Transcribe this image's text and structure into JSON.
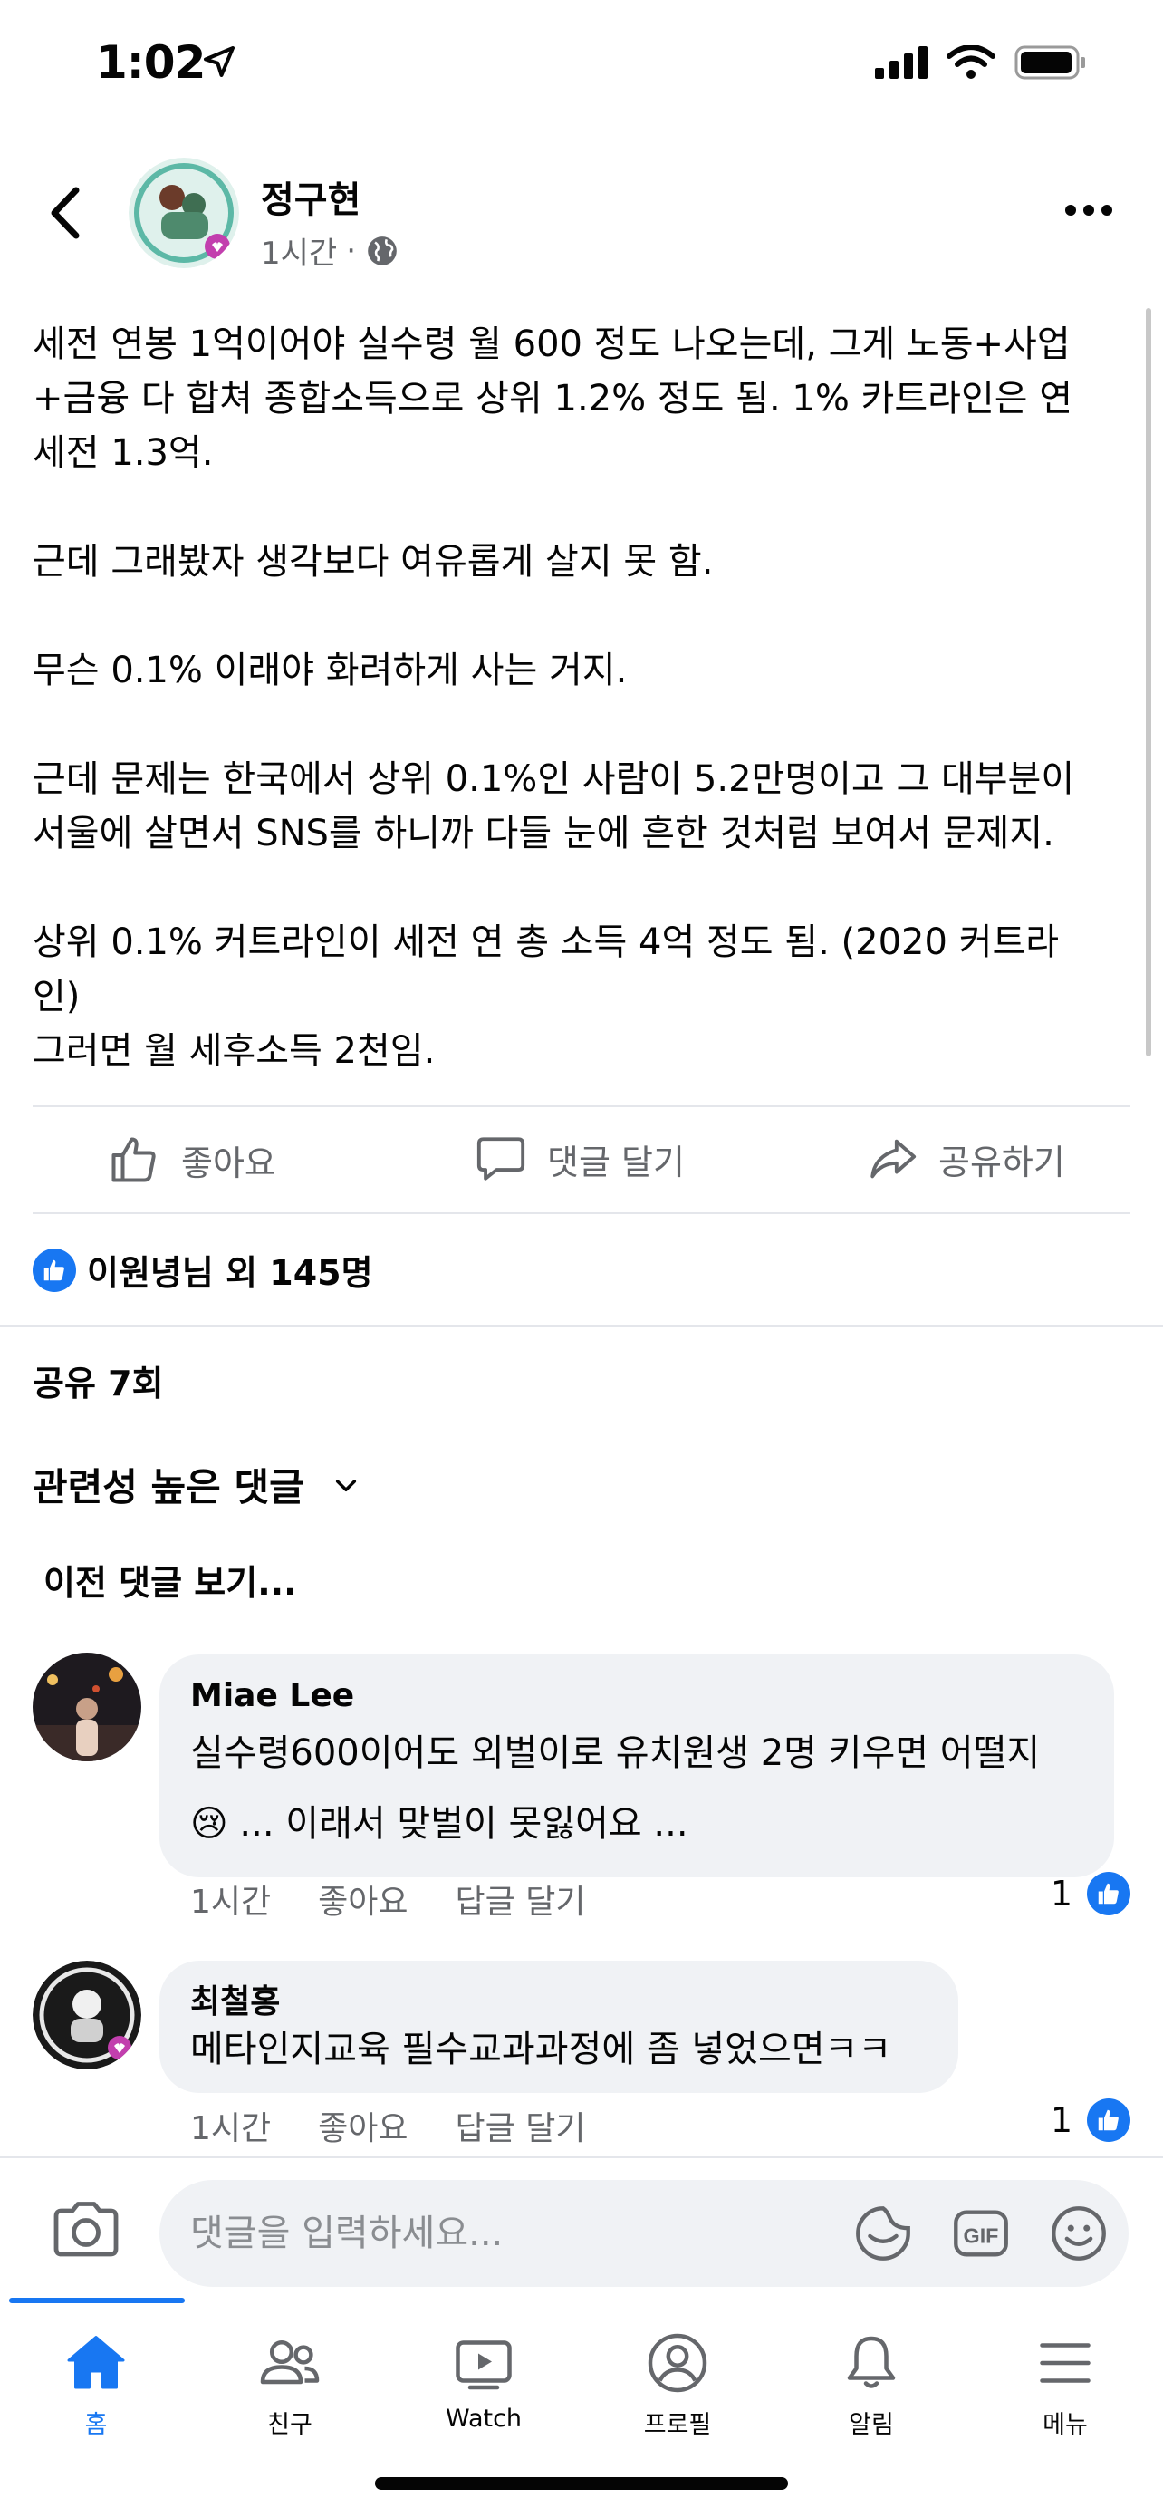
{
  "status_bar": {
    "time": "1:02"
  },
  "post": {
    "author": "정구현",
    "time": "1시간",
    "separator": "·",
    "paragraphs": [
      "세전 연봉 1억이어야 실수령 월 600 정도 나오는데, 그게 노동+사업",
      "+금융 다 합쳐 종합소득으로 상위 1.2% 정도 됨. 1% 카트라인은 연",
      "세전 1.3억.",
      "",
      "근데 그래봤자 생각보다 여유롭게 살지 못 함.",
      "",
      "무슨 0.1% 이래야 화려하게 사는 거지.",
      "",
      "근데 문제는 한국에서 상위 0.1%인 사람이 5.2만명이고 그 대부분이",
      "서울에 살면서 SNS를 하니까 다들 눈에 흔한 것처럼 보여서 문제지.",
      "",
      "상위 0.1% 커트라인이 세전 연 총 소득 4억 정도 됨. (2020 커트라",
      "인)",
      "그러면 월 세후소득 2천임."
    ]
  },
  "actions": {
    "like": "좋아요",
    "comment": "댓글 달기",
    "share": "공유하기"
  },
  "reactions": {
    "text": "이원녕님 외 145명"
  },
  "shares": "공유 7회",
  "comments_section": {
    "sort_label": "관련성 높은 댓글",
    "previous": "이전 댓글 보기..."
  },
  "comments": [
    {
      "name": "Miae Lee",
      "line1": "실수령600이어도 외벌이로 유치원생 2명 키우면 어떨지",
      "line2_emoji": "😢",
      "line2": "... 이래서 맞벌이 못잃어요 ...",
      "time": "1시간",
      "like": "좋아요",
      "reply": "답글 달기",
      "likes": "1"
    },
    {
      "name": "최철홍",
      "line1": "메타인지교육 필수교과과정에 좀 넣었으면ㅋㅋ",
      "time": "1시간",
      "like": "좋아요",
      "reply": "답글 달기",
      "likes": "1"
    }
  ],
  "input": {
    "placeholder": "댓글을 입력하세요...",
    "gif": "GIF"
  },
  "nav": {
    "items": [
      {
        "label": "홈",
        "icon": "home-icon",
        "active": true
      },
      {
        "label": "친구",
        "icon": "friends-icon"
      },
      {
        "label": "Watch",
        "icon": "watch-icon"
      },
      {
        "label": "프로필",
        "icon": "profile-icon"
      },
      {
        "label": "알림",
        "icon": "bell-icon"
      },
      {
        "label": "메뉴",
        "icon": "menu-icon"
      }
    ]
  },
  "colors": {
    "accent": "#1877f2",
    "secondary_text": "#65676b",
    "bubble": "#f0f2f5"
  }
}
